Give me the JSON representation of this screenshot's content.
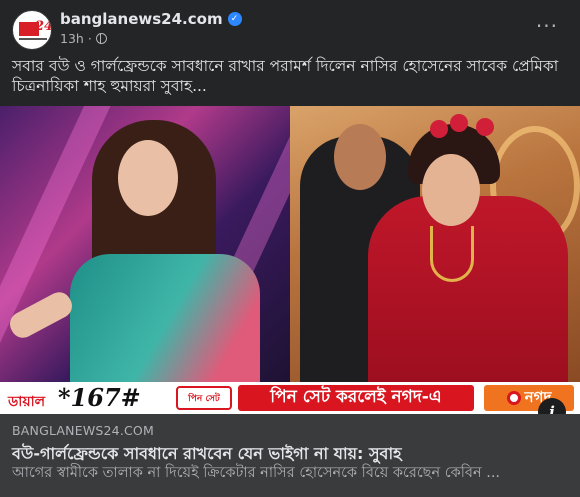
{
  "header": {
    "page_name": "banglanews24.com",
    "time": "13h",
    "separator": "·",
    "more_label": "···",
    "verified_glyph": "✓"
  },
  "avatar": {
    "logo_text": "24"
  },
  "caption": "সবার বউ ও গার্লফ্রেন্ডকে সাবধানে রাখার পরামর্শ দিলেন নাসির হোসেনের সাবেক প্রেমিকা চিত্রনায়িকা শাহ হুমায়রা সুবাহ...",
  "ad_banner": {
    "dial_label": "ডায়াল",
    "code": "*167#",
    "mid_label": "পিন সেট",
    "red_text": "পিন সেট করলেই নগদ-এ",
    "logo_text": "নগদ"
  },
  "info_label": "i",
  "link_preview": {
    "domain": "BANGLANEWS24.COM",
    "title": "বউ-গার্লফ্রেন্ডকে সাবধানে রাখবেন যেন ভাইগা না যায়: সুবাহ",
    "description": "আগের স্বামীকে তালাক না দিয়েই ক্রিকেটার নাসির হোসেনকে বিয়ে করেছেন কেবিন ..."
  },
  "colors": {
    "background": "#242526",
    "card": "#3a3b3c",
    "text_primary": "#e4e6eb",
    "text_secondary": "#b0b3b8",
    "verified": "#2d88ff",
    "brand_red": "#d9151f",
    "brand_orange": "#f0731f"
  },
  "icons": {
    "verified": "verified-badge-icon",
    "privacy": "globe-icon",
    "more": "more-options-icon",
    "info": "info-icon"
  }
}
